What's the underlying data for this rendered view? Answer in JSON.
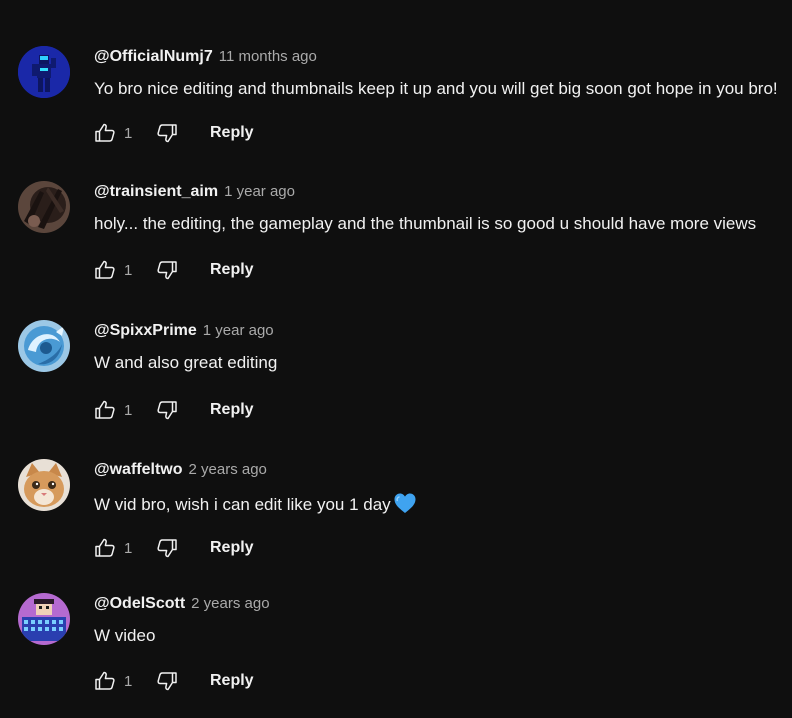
{
  "reply_label": "Reply",
  "comments": [
    {
      "author": "@OfficialNumj7",
      "time": "11 months ago",
      "text": "Yo bro nice editing and thumbnails keep it up and you will get big soon got hope in you bro!",
      "likes": "1",
      "avatar_icon": "blue-figure-avatar-icon",
      "avatar_color": "#1c2bb8"
    },
    {
      "author": "@trainsient_aim",
      "time": "1 year ago",
      "text": "holy... the editing, the gameplay and the thumbnail is so good u should have more views",
      "likes": "1",
      "avatar_icon": "dark-creature-avatar-icon",
      "avatar_color": "#4a3a34"
    },
    {
      "author": "@SpixxPrime",
      "time": "1 year ago",
      "text": "W and also great editing",
      "likes": "1",
      "avatar_icon": "blue-swirl-avatar-icon",
      "avatar_color": "#5aa8d8"
    },
    {
      "author": "@waffeltwo",
      "time": "2 years ago",
      "text": "W vid bro, wish i can edit like you 1 day",
      "likes": "1",
      "avatar_icon": "kitten-avatar-icon",
      "avatar_color": "#c89a6a",
      "emoji": "blue-heart-icon",
      "emoji_color": "#3fa3f0"
    },
    {
      "author": "@OdelScott",
      "time": "2 years ago",
      "text": "W video",
      "likes": "1",
      "avatar_icon": "pixel-character-avatar-icon",
      "avatar_color": "#b56ad0"
    }
  ]
}
